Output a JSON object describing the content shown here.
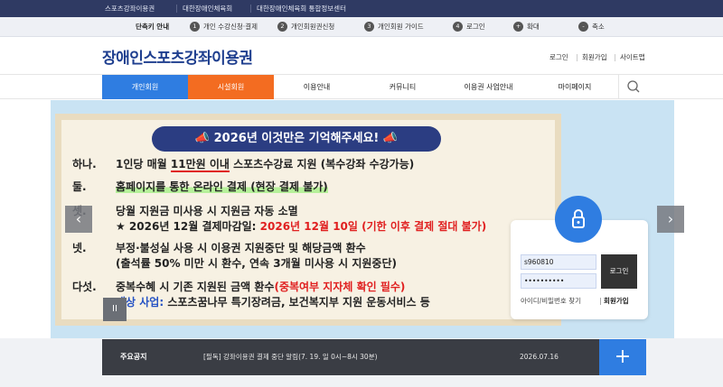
{
  "topbar": {
    "links": [
      "스포츠강좌이용권",
      "대한장애인체육회",
      "대한장애인체육회 통합정보센터"
    ]
  },
  "skip_nav": {
    "title": "단축키 안내",
    "items": [
      {
        "num": "1",
        "label": "개인 수강신청·결제"
      },
      {
        "num": "2",
        "label": "개인회원권신청"
      },
      {
        "num": "3",
        "label": "개인회원 가이드"
      },
      {
        "num": "4",
        "label": "로그인"
      },
      {
        "num": "+",
        "label": "확대"
      },
      {
        "num": "-",
        "label": "축소"
      }
    ]
  },
  "header": {
    "logo": "장애인스포츠강좌이용권",
    "util": [
      "로그인",
      "회원가입",
      "사이트맵"
    ]
  },
  "gnb": {
    "items": [
      "개인회원",
      "시설회원",
      "이용안내",
      "커뮤니티",
      "이용권 사업안내",
      "마이페이지"
    ],
    "search_icon": "search-icon"
  },
  "banner": {
    "title": "📣 2026년 이것만은 기억해주세요! 📣",
    "lines": [
      {
        "label": "하나.",
        "text_a": "1인당 매월 ",
        "text_b": "11만원 이내",
        "text_c": " 스포츠수강료 지원 (복수강좌 수강가능)"
      },
      {
        "label": "둘.",
        "text": "홈페이지를 통한 온라인 결제 (현장 결제 불가)"
      },
      {
        "label": "셋.",
        "text": "당월 지원금 미사용 시 지원금 자동 소멸"
      },
      {
        "label": "",
        "text_a": "★ 2026년 12월 결제마감일: ",
        "text_b": "2026년 12월 10일 (기한 이후 결제 절대 불가)"
      },
      {
        "label": "넷.",
        "text": "부정·불성실 사용 시 이용권 지원중단 및 해당금액 환수"
      },
      {
        "label": "",
        "text": "(출석률 50% 미만 시 환수, 연속 3개월 미사용 시 지원중단)"
      },
      {
        "label": "다섯.",
        "text_a": "중복수혜 시 기존 지원된 금액 환수",
        "text_b": "(중복여부 지자체 확인 필수)"
      },
      {
        "label": "",
        "text_a": "대상 사업: ",
        "text_b": "스포츠꿈나무 특기장려금, 보건복지부 지원 운동서비스 등"
      }
    ],
    "prev": "‹",
    "next": "›",
    "pause": "II"
  },
  "login": {
    "id_value": "s960810",
    "pw_value": "••••••••••",
    "button": "로그인",
    "find": "아이디/비밀번호 찾기",
    "join": "회원가입"
  },
  "notice": {
    "label": "주요공지",
    "text": "[필독] 강좌이용권 결제 중단 알림(7. 19. 일 0시~8시 30분)",
    "date": "2026.07.16",
    "more": "+"
  },
  "colors": {
    "topbar": "#2f3a63",
    "personal": "#2f7de1",
    "facility": "#f36c21",
    "banner": "#c9e3f3"
  }
}
